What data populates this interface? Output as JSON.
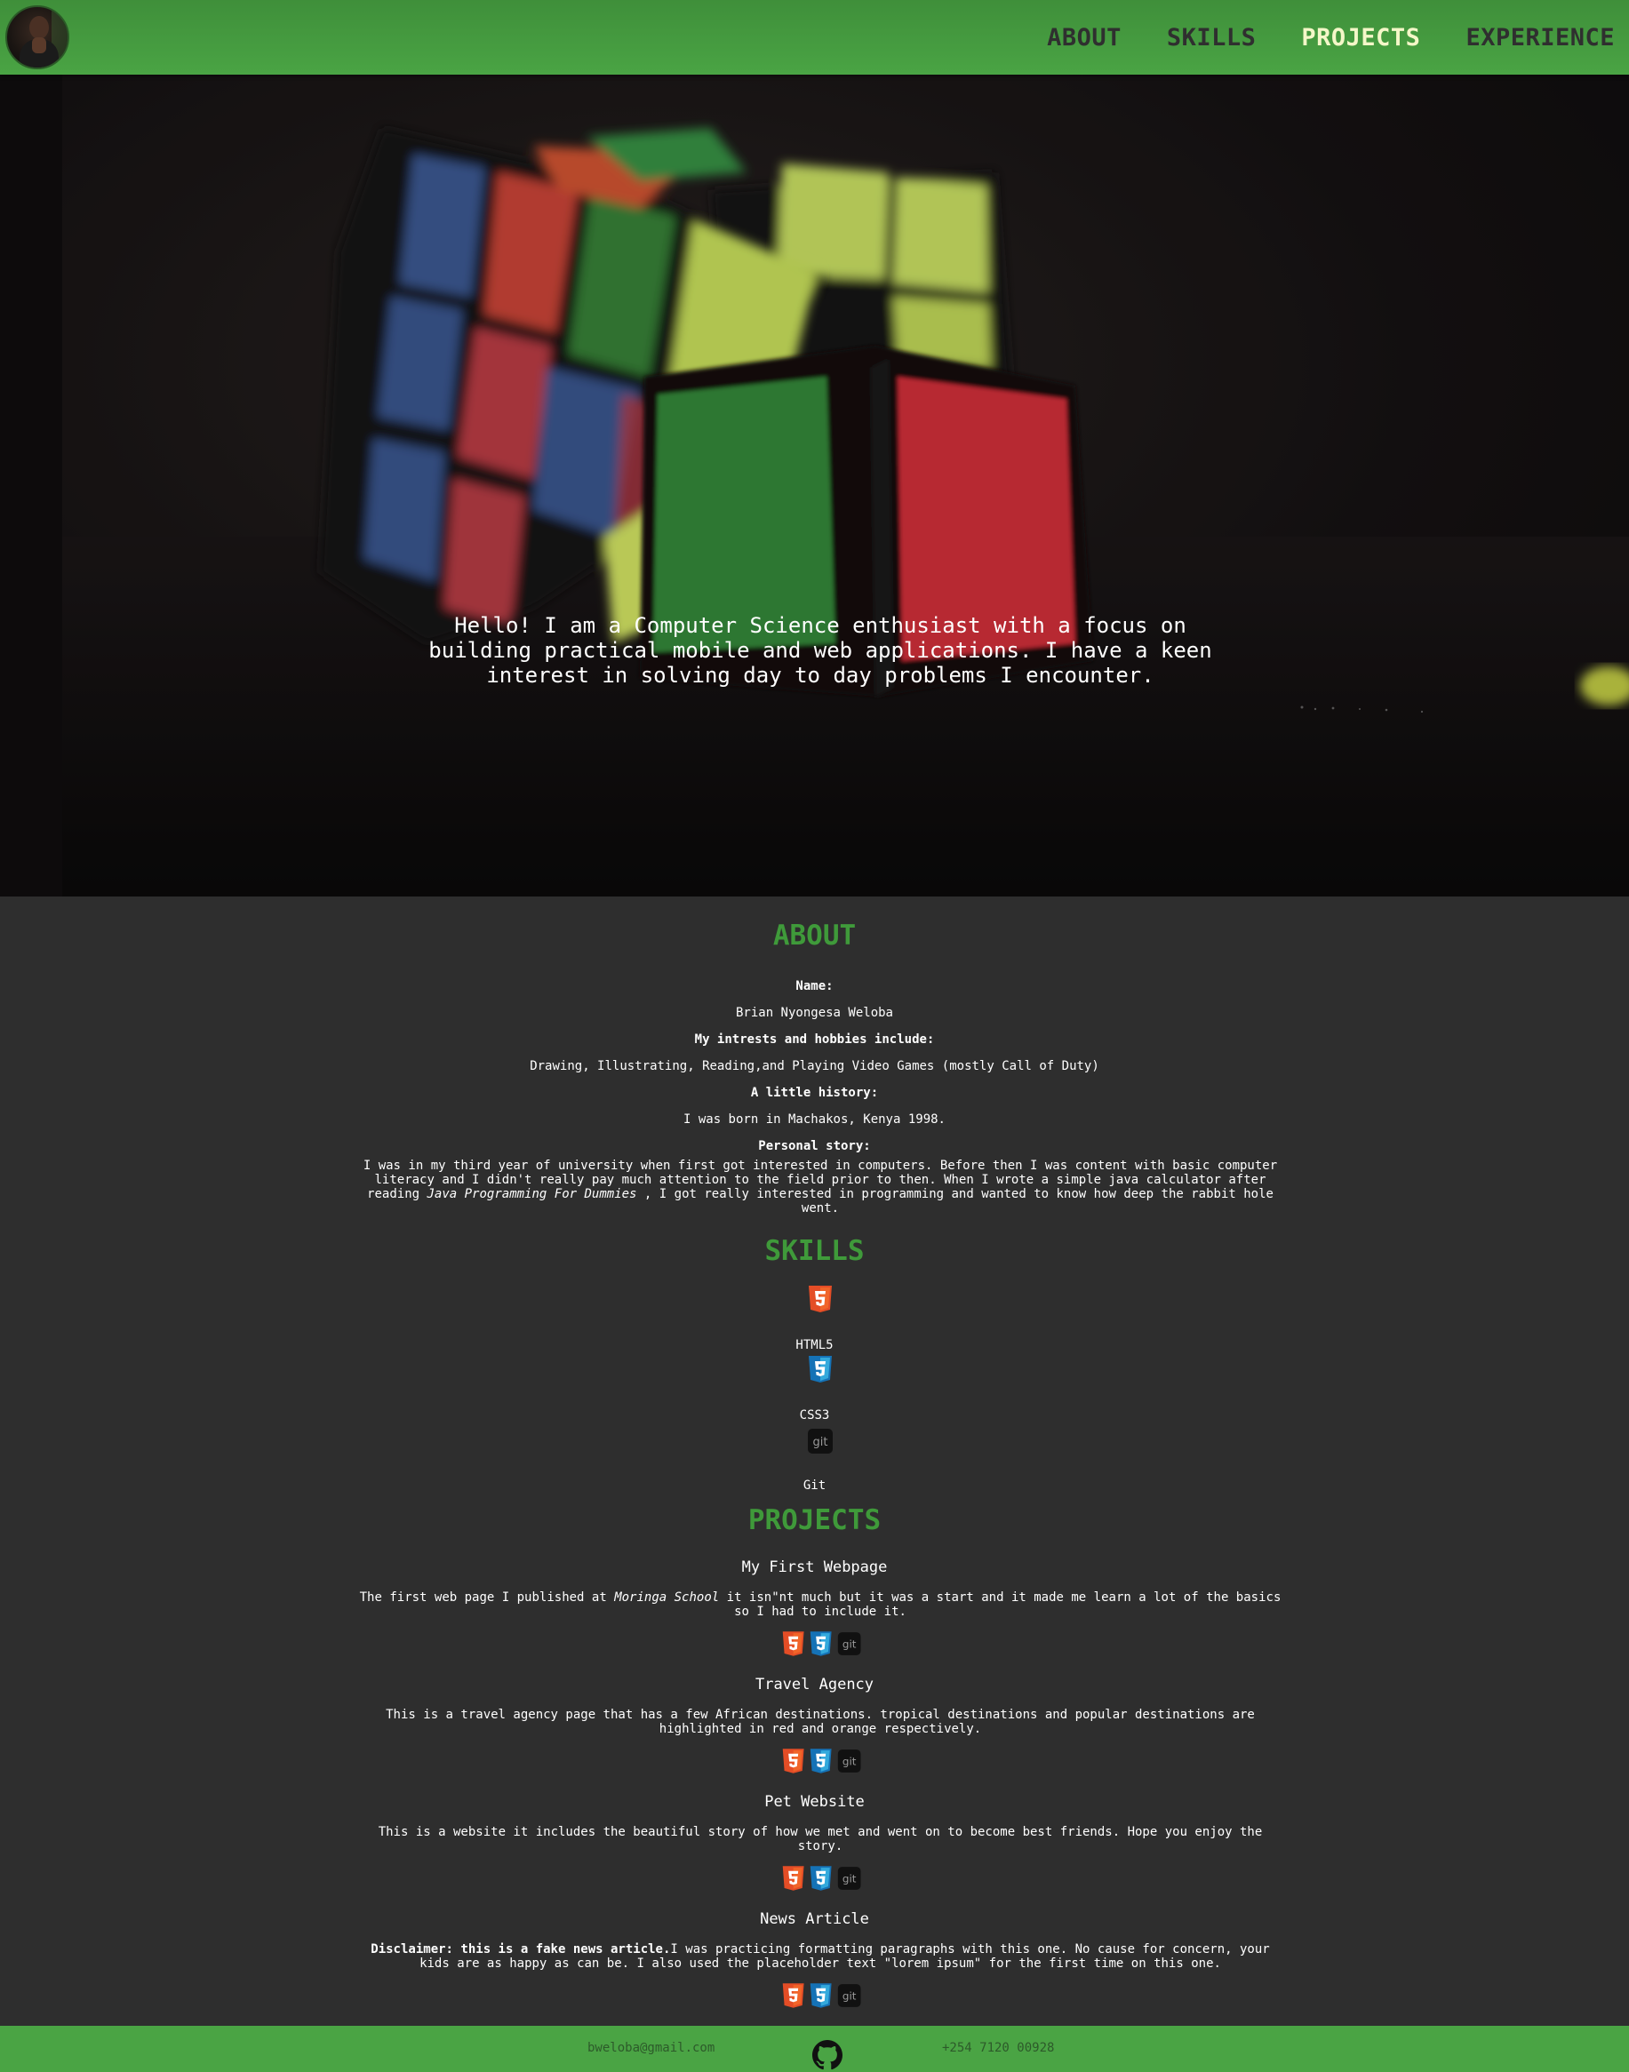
{
  "nav": {
    "links": [
      {
        "label": "ABOUT",
        "active": false
      },
      {
        "label": "SKILLS",
        "active": false
      },
      {
        "label": "PROJECTS",
        "active": true
      },
      {
        "label": "EXPERIENCE",
        "active": false
      }
    ]
  },
  "hero": {
    "text": "Hello! I am a Computer Science enthusiast with a focus on building practical mobile and web applications. I have a keen interest in solving day to day problems I encounter."
  },
  "about": {
    "heading": "ABOUT",
    "name_label": "Name:",
    "name_value": "Brian Nyongesa Weloba",
    "hobbies_label": "My intrests and hobbies include:",
    "hobbies_value": "Drawing, Illustrating, Reading,and Playing Video Games (mostly Call of Duty)",
    "history_label": "A little history:",
    "history_value": "I was born in Machakos, Kenya 1998.",
    "story_label": "Personal story:",
    "story_part1": "I was in my third year of university when first got interested in computers. Before then I was content with basic computer literacy and I didn't really pay much attention to the field prior to then. When I wrote a simple java calculator after reading ",
    "story_book": "Java Programming For Dummies",
    "story_part2": " , I got really interested in programming and wanted to know how deep the rabbit hole went."
  },
  "skills": {
    "heading": "SKILLS",
    "items": [
      {
        "name": "HTML5",
        "icon": "html5-icon",
        "color": "#e44d26"
      },
      {
        "name": "CSS3",
        "icon": "css3-icon",
        "color": "#2f7bc4"
      },
      {
        "name": "Git",
        "icon": "git-icon",
        "color": "#111111"
      }
    ]
  },
  "projects": {
    "heading": "PROJECTS",
    "items": [
      {
        "title": "My First Webpage",
        "desc_part1": "The first web page I published at ",
        "desc_em": "Moringa School",
        "desc_part2": " it isn\"nt much but it was a start and it made me learn a lot of the basics so I had to include it."
      },
      {
        "title": "Travel Agency",
        "desc": "This is a travel agency page that has a few African destinations. tropical destinations and popular destinations are highlighted in red and orange respectively."
      },
      {
        "title": "Pet Website",
        "desc": "This is a website it includes the beautiful story of how we met and went on to become best friends. Hope you enjoy the story."
      },
      {
        "title": "News Article",
        "desc_strong": "Disclaimer: this is a fake news article.",
        "desc": "I was practicing formatting paragraphs with this one. No cause for concern, your kids are as happy as can be. I also used the placeholder text \"lorem ipsum\" for the first time on this one."
      }
    ]
  },
  "footer": {
    "email": "bweloba@gmail.com",
    "github_icon": "github-icon",
    "phone": "+254 7120 00928"
  },
  "colors": {
    "nav_green": "#4aa444",
    "heading_green": "#3f9a3a",
    "background": "#2e2e2e",
    "active_link": "#f4f7c8"
  }
}
